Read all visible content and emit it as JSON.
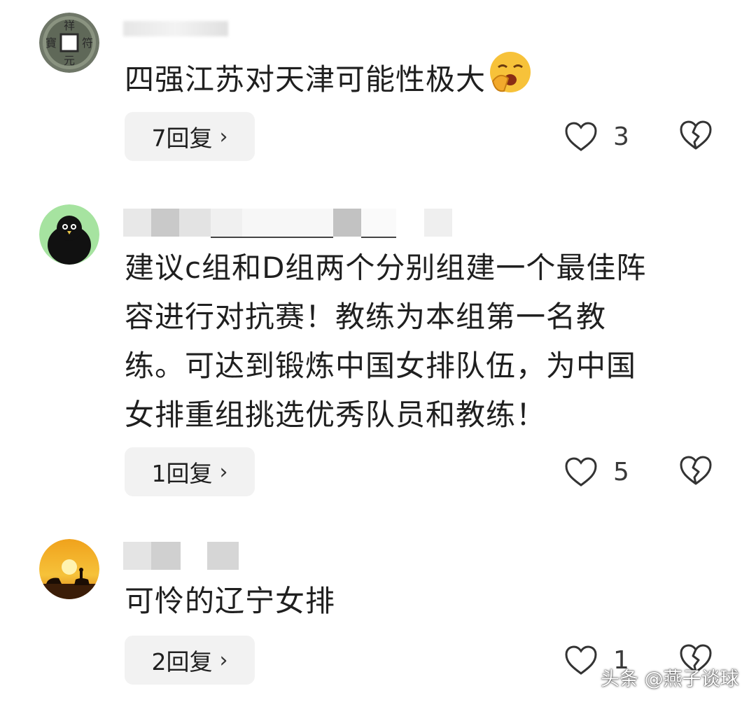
{
  "comments": [
    {
      "avatar_icon": "coin-avatar",
      "text": "四强江苏对天津可能性极大",
      "emoji_icon": "yawning-face-emoji-icon",
      "reply_label": "7回复",
      "like_count": "3"
    },
    {
      "avatar_icon": "black-bird-avatar",
      "text_lines": [
        "建议c组和D组两个分别组建一个最佳阵",
        "容进行对抗赛！教练为本组第一名教",
        "练。可达到锻炼中国女排队伍，为中国",
        "女排重组挑选优秀队员和教练！"
      ],
      "reply_label": "1回复",
      "like_count": "5"
    },
    {
      "avatar_icon": "sunset-buffalo-avatar",
      "text": "可怜的辽宁女排",
      "reply_label": "2回复",
      "like_count": "1"
    }
  ],
  "watermark": "头条 @燕子谈球",
  "colors": {
    "text": "#1f1f1f",
    "reply_bg": "#f2f2f2",
    "icon": "#333333"
  }
}
